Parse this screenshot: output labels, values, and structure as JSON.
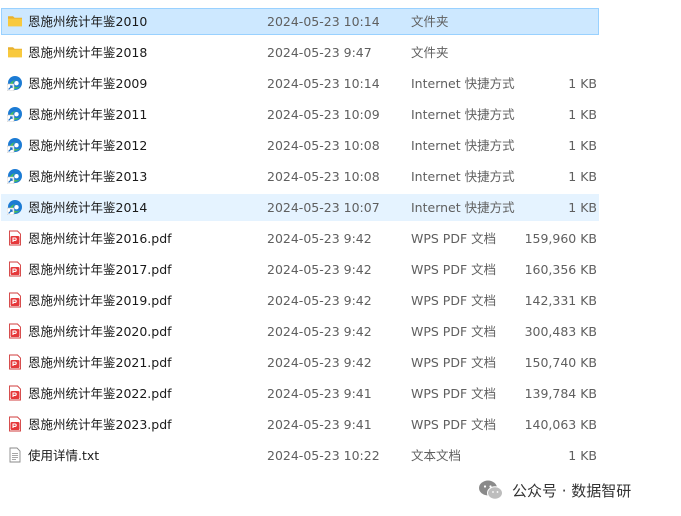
{
  "files": [
    {
      "name": "恩施州统计年鉴2010",
      "date": "2024-05-23 10:14",
      "type": "文件夹",
      "size": "",
      "icon": "folder-icon",
      "state": "selected"
    },
    {
      "name": "恩施州统计年鉴2018",
      "date": "2024-05-23 9:47",
      "type": "文件夹",
      "size": "",
      "icon": "folder-icon",
      "state": ""
    },
    {
      "name": "恩施州统计年鉴2009",
      "date": "2024-05-23 10:14",
      "type": "Internet 快捷方式",
      "size": "1 KB",
      "icon": "edge-shortcut-icon",
      "state": ""
    },
    {
      "name": "恩施州统计年鉴2011",
      "date": "2024-05-23 10:09",
      "type": "Internet 快捷方式",
      "size": "1 KB",
      "icon": "edge-shortcut-icon",
      "state": ""
    },
    {
      "name": "恩施州统计年鉴2012",
      "date": "2024-05-23 10:08",
      "type": "Internet 快捷方式",
      "size": "1 KB",
      "icon": "edge-shortcut-icon",
      "state": ""
    },
    {
      "name": "恩施州统计年鉴2013",
      "date": "2024-05-23 10:08",
      "type": "Internet 快捷方式",
      "size": "1 KB",
      "icon": "edge-shortcut-icon",
      "state": ""
    },
    {
      "name": "恩施州统计年鉴2014",
      "date": "2024-05-23 10:07",
      "type": "Internet 快捷方式",
      "size": "1 KB",
      "icon": "edge-shortcut-icon",
      "state": "hovered"
    },
    {
      "name": "恩施州统计年鉴2016.pdf",
      "date": "2024-05-23 9:42",
      "type": "WPS PDF 文档",
      "size": "159,960 KB",
      "icon": "wps-pdf-icon",
      "state": ""
    },
    {
      "name": "恩施州统计年鉴2017.pdf",
      "date": "2024-05-23 9:42",
      "type": "WPS PDF 文档",
      "size": "160,356 KB",
      "icon": "wps-pdf-icon",
      "state": ""
    },
    {
      "name": "恩施州统计年鉴2019.pdf",
      "date": "2024-05-23 9:42",
      "type": "WPS PDF 文档",
      "size": "142,331 KB",
      "icon": "wps-pdf-icon",
      "state": ""
    },
    {
      "name": "恩施州统计年鉴2020.pdf",
      "date": "2024-05-23 9:42",
      "type": "WPS PDF 文档",
      "size": "300,483 KB",
      "icon": "wps-pdf-icon",
      "state": ""
    },
    {
      "name": "恩施州统计年鉴2021.pdf",
      "date": "2024-05-23 9:42",
      "type": "WPS PDF 文档",
      "size": "150,740 KB",
      "icon": "wps-pdf-icon",
      "state": ""
    },
    {
      "name": "恩施州统计年鉴2022.pdf",
      "date": "2024-05-23 9:41",
      "type": "WPS PDF 文档",
      "size": "139,784 KB",
      "icon": "wps-pdf-icon",
      "state": ""
    },
    {
      "name": "恩施州统计年鉴2023.pdf",
      "date": "2024-05-23 9:41",
      "type": "WPS PDF 文档",
      "size": "140,063 KB",
      "icon": "wps-pdf-icon",
      "state": ""
    },
    {
      "name": "使用详情.txt",
      "date": "2024-05-23 10:22",
      "type": "文本文档",
      "size": "1 KB",
      "icon": "text-file-icon",
      "state": ""
    }
  ],
  "watermark": {
    "text": "公众号 · 数据智研",
    "icon": "wechat-logo-icon"
  },
  "colors": {
    "selected_bg": "#cde8ff",
    "selected_border": "#99d1ff",
    "hover_bg": "#e5f3ff",
    "folder": "#f8c93e",
    "pdf": "#e5393b",
    "edge_blue": "#1c7bd4",
    "edge_green": "#46c15a"
  }
}
